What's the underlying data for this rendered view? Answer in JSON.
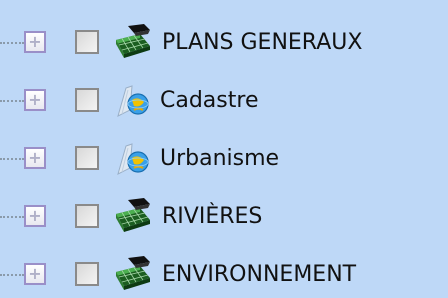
{
  "layer_tree": {
    "items": [
      {
        "label": "PLANS GENERAUX",
        "icon": "map-layer-icon",
        "expander": "+",
        "checked": false
      },
      {
        "label": "Cadastre",
        "icon": "globe-search-icon",
        "expander": "+",
        "checked": false
      },
      {
        "label": "Urbanisme",
        "icon": "globe-search-icon",
        "expander": "+",
        "checked": false
      },
      {
        "label": "RIVIÈRES",
        "icon": "map-layer-icon",
        "expander": "+",
        "checked": false
      },
      {
        "label": "ENVIRONNEMENT",
        "icon": "map-layer-icon",
        "expander": "+",
        "checked": false
      }
    ]
  },
  "colors": {
    "background": "#bed8f7",
    "text": "#111111",
    "expander_border": "#9a8fc8",
    "checkbox_border": "#8a8a8a"
  }
}
